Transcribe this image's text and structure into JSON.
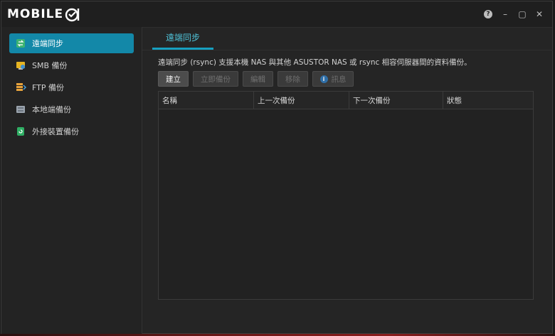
{
  "window": {
    "logo_text": "MOBILE",
    "controls": {
      "help": "?",
      "minimize": "–",
      "maximize": "▢",
      "close": "✕"
    }
  },
  "sidebar": {
    "items": [
      {
        "label": "遠端同步",
        "icon": "rsync-icon",
        "active": true
      },
      {
        "label": "SMB 備份",
        "icon": "smb-backup-icon"
      },
      {
        "label": "FTP 備份",
        "icon": "ftp-backup-icon"
      },
      {
        "label": "本地端備份",
        "icon": "local-backup-icon"
      },
      {
        "label": "外接裝置備份",
        "icon": "external-device-backup-icon"
      }
    ]
  },
  "main": {
    "tab": "遠端同步",
    "description": "遠端同步 (rsync) 支援本機 NAS 與其他 ASUSTOR NAS 或 rsync 相容伺服器間的資料備份。",
    "toolbar": {
      "create": "建立",
      "backup_now": "立即備份",
      "edit": "編輯",
      "remove": "移除",
      "info": "訊息"
    },
    "table": {
      "columns": [
        "名稱",
        "上一次備份",
        "下一次備份",
        "狀態"
      ],
      "rows": []
    }
  },
  "colors": {
    "accent": "#1388a8",
    "tab_text": "#4fc3d9",
    "background": "#252525"
  }
}
